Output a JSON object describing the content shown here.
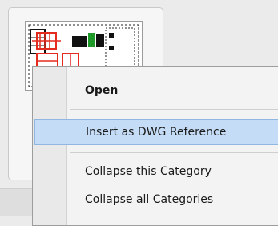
{
  "context_menu": {
    "items": [
      {
        "label": "Open"
      },
      {
        "label": "Insert as DWG Reference"
      },
      {
        "label": "Collapse this Category"
      },
      {
        "label": "Collapse all Categories"
      }
    ]
  },
  "colors": {
    "highlight": "#c4dcf5",
    "highlight_border": "#8fb7e0",
    "drawing_red": "#e32b1e",
    "drawing_green": "#1f9a2a"
  }
}
